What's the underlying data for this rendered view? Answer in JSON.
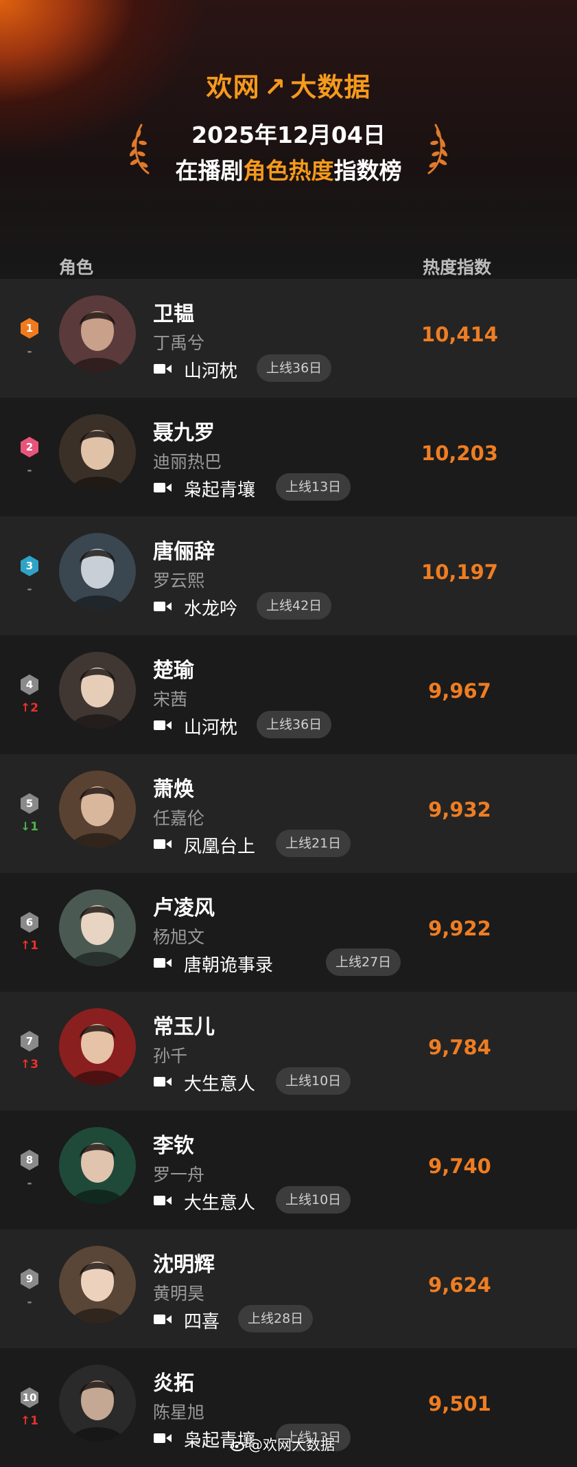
{
  "header": {
    "brand_left": "欢网",
    "brand_right": "大数据",
    "date": "2025年12月04日",
    "subtitle_pre": "在播剧",
    "subtitle_hl": "角色热度",
    "subtitle_post": "指数榜"
  },
  "columns": {
    "role": "角色",
    "heat": "热度指数"
  },
  "colors": {
    "accent": "#f59a1c",
    "score": "#ef7d22",
    "up": "#e8322a",
    "down": "#4fb14b"
  },
  "rows": [
    {
      "rank": "1",
      "badge_color": "#f07a1e",
      "change": "-",
      "change_dir": "same",
      "name": "卫韫",
      "actor": "丁禹兮",
      "show": "山河枕",
      "days": "上线36日",
      "score": "10,414",
      "avatar_bg": "#5a3a3a",
      "avatar_fg": "#c9a08a"
    },
    {
      "rank": "2",
      "badge_color": "#e8557a",
      "change": "-",
      "change_dir": "same",
      "name": "聂九罗",
      "actor": "迪丽热巴",
      "show": "枭起青壤",
      "days": "上线13日",
      "score": "10,203",
      "avatar_bg": "#3a3028",
      "avatar_fg": "#e0c2a8"
    },
    {
      "rank": "3",
      "badge_color": "#2fa3c6",
      "change": "-",
      "change_dir": "same",
      "name": "唐俪辞",
      "actor": "罗云熙",
      "show": "水龙吟",
      "days": "上线42日",
      "score": "10,197",
      "avatar_bg": "#3a4650",
      "avatar_fg": "#c9cfd6"
    },
    {
      "rank": "4",
      "badge_color": "#8a8a8a",
      "change": "↑2",
      "change_dir": "up",
      "name": "楚瑜",
      "actor": "宋茜",
      "show": "山河枕",
      "days": "上线36日",
      "score": "9,967",
      "avatar_bg": "#403632",
      "avatar_fg": "#e6cdb8"
    },
    {
      "rank": "5",
      "badge_color": "#8a8a8a",
      "change": "↓1",
      "change_dir": "down",
      "name": "萧焕",
      "actor": "任嘉伦",
      "show": "凤凰台上",
      "days": "上线21日",
      "score": "9,932",
      "avatar_bg": "#5a4232",
      "avatar_fg": "#d9b79c"
    },
    {
      "rank": "6",
      "badge_color": "#8a8a8a",
      "change": "↑1",
      "change_dir": "up",
      "name": "卢凌风",
      "actor": "杨旭文",
      "show": "唐朝诡事录",
      "days": "上线27日",
      "score": "9,922",
      "avatar_bg": "#4a5a52",
      "avatar_fg": "#e8d4c2"
    },
    {
      "rank": "7",
      "badge_color": "#8a8a8a",
      "change": "↑3",
      "change_dir": "up",
      "name": "常玉儿",
      "actor": "孙千",
      "show": "大生意人",
      "days": "上线10日",
      "score": "9,784",
      "avatar_bg": "#8a1f1f",
      "avatar_fg": "#e6c2a6"
    },
    {
      "rank": "8",
      "badge_color": "#8a8a8a",
      "change": "-",
      "change_dir": "same",
      "name": "李钦",
      "actor": "罗一舟",
      "show": "大生意人",
      "days": "上线10日",
      "score": "9,740",
      "avatar_bg": "#1f4a3a",
      "avatar_fg": "#e0c4ae"
    },
    {
      "rank": "9",
      "badge_color": "#8a8a8a",
      "change": "-",
      "change_dir": "same",
      "name": "沈明辉",
      "actor": "黄明昊",
      "show": "四喜",
      "days": "上线28日",
      "score": "9,624",
      "avatar_bg": "#5a4636",
      "avatar_fg": "#ecd2bd"
    },
    {
      "rank": "10",
      "badge_color": "#8a8a8a",
      "change": "↑1",
      "change_dir": "up",
      "name": "炎拓",
      "actor": "陈星旭",
      "show": "枭起青壤",
      "days": "上线13日",
      "score": "9,501",
      "avatar_bg": "#2a2a2a",
      "avatar_fg": "#c4a894"
    }
  ],
  "watermark": "@欢网大数据"
}
